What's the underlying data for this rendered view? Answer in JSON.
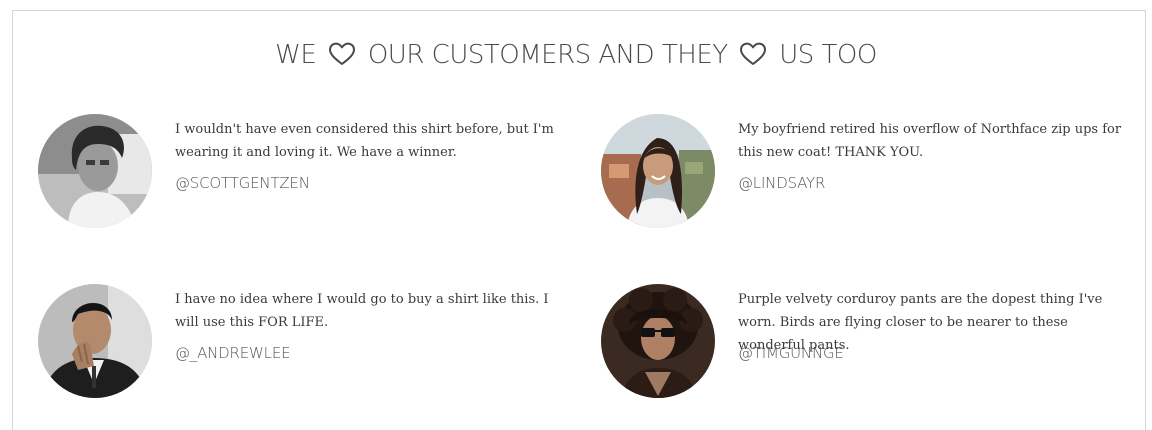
{
  "header": {
    "prefix": "WE",
    "middle": "OUR CUSTOMERS AND THEY",
    "suffix": "US TOO",
    "heart_icon": "heart-outline-icon"
  },
  "testimonials": [
    {
      "quote": "I wouldn't have even considered this shirt before, but I'm wearing it and loving it. We have a winner.",
      "handle": "@SCOTTGENTZEN"
    },
    {
      "quote": "My boyfriend retired his overflow of Northface zip ups for this new coat! THANK YOU.",
      "handle": "@LINDSAYR"
    },
    {
      "quote": "I have no idea where I would go to buy a shirt like this. I will use this FOR LIFE.",
      "handle": "@_ANDREWLEE"
    },
    {
      "quote": "Purple velvety corduroy pants are the dopest thing I've worn. Birds are flying closer to be nearer to these wonderful pants.",
      "handle": "@TIMGUNNGE"
    }
  ]
}
